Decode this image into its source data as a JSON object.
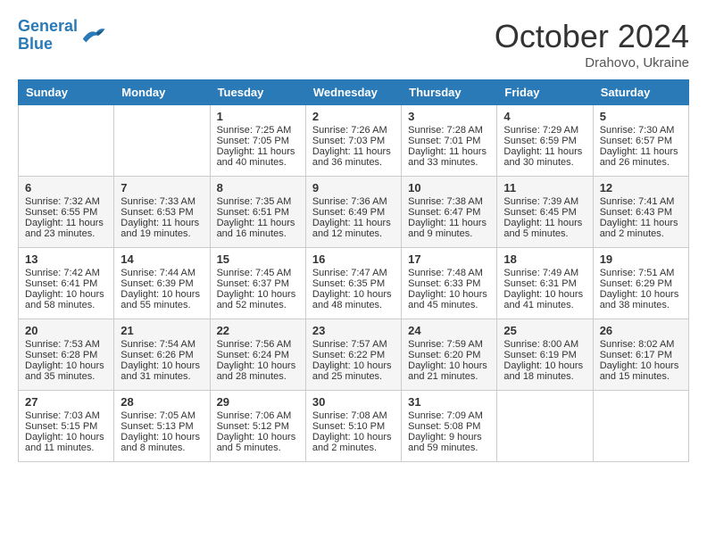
{
  "header": {
    "logo_line1": "General",
    "logo_line2": "Blue",
    "month": "October 2024",
    "location": "Drahovo, Ukraine"
  },
  "weekdays": [
    "Sunday",
    "Monday",
    "Tuesday",
    "Wednesday",
    "Thursday",
    "Friday",
    "Saturday"
  ],
  "rows": [
    [
      {
        "day": "",
        "info": ""
      },
      {
        "day": "",
        "info": ""
      },
      {
        "day": "1",
        "info": "Sunrise: 7:25 AM\nSunset: 7:05 PM\nDaylight: 11 hours and 40 minutes."
      },
      {
        "day": "2",
        "info": "Sunrise: 7:26 AM\nSunset: 7:03 PM\nDaylight: 11 hours and 36 minutes."
      },
      {
        "day": "3",
        "info": "Sunrise: 7:28 AM\nSunset: 7:01 PM\nDaylight: 11 hours and 33 minutes."
      },
      {
        "day": "4",
        "info": "Sunrise: 7:29 AM\nSunset: 6:59 PM\nDaylight: 11 hours and 30 minutes."
      },
      {
        "day": "5",
        "info": "Sunrise: 7:30 AM\nSunset: 6:57 PM\nDaylight: 11 hours and 26 minutes."
      }
    ],
    [
      {
        "day": "6",
        "info": "Sunrise: 7:32 AM\nSunset: 6:55 PM\nDaylight: 11 hours and 23 minutes."
      },
      {
        "day": "7",
        "info": "Sunrise: 7:33 AM\nSunset: 6:53 PM\nDaylight: 11 hours and 19 minutes."
      },
      {
        "day": "8",
        "info": "Sunrise: 7:35 AM\nSunset: 6:51 PM\nDaylight: 11 hours and 16 minutes."
      },
      {
        "day": "9",
        "info": "Sunrise: 7:36 AM\nSunset: 6:49 PM\nDaylight: 11 hours and 12 minutes."
      },
      {
        "day": "10",
        "info": "Sunrise: 7:38 AM\nSunset: 6:47 PM\nDaylight: 11 hours and 9 minutes."
      },
      {
        "day": "11",
        "info": "Sunrise: 7:39 AM\nSunset: 6:45 PM\nDaylight: 11 hours and 5 minutes."
      },
      {
        "day": "12",
        "info": "Sunrise: 7:41 AM\nSunset: 6:43 PM\nDaylight: 11 hours and 2 minutes."
      }
    ],
    [
      {
        "day": "13",
        "info": "Sunrise: 7:42 AM\nSunset: 6:41 PM\nDaylight: 10 hours and 58 minutes."
      },
      {
        "day": "14",
        "info": "Sunrise: 7:44 AM\nSunset: 6:39 PM\nDaylight: 10 hours and 55 minutes."
      },
      {
        "day": "15",
        "info": "Sunrise: 7:45 AM\nSunset: 6:37 PM\nDaylight: 10 hours and 52 minutes."
      },
      {
        "day": "16",
        "info": "Sunrise: 7:47 AM\nSunset: 6:35 PM\nDaylight: 10 hours and 48 minutes."
      },
      {
        "day": "17",
        "info": "Sunrise: 7:48 AM\nSunset: 6:33 PM\nDaylight: 10 hours and 45 minutes."
      },
      {
        "day": "18",
        "info": "Sunrise: 7:49 AM\nSunset: 6:31 PM\nDaylight: 10 hours and 41 minutes."
      },
      {
        "day": "19",
        "info": "Sunrise: 7:51 AM\nSunset: 6:29 PM\nDaylight: 10 hours and 38 minutes."
      }
    ],
    [
      {
        "day": "20",
        "info": "Sunrise: 7:53 AM\nSunset: 6:28 PM\nDaylight: 10 hours and 35 minutes."
      },
      {
        "day": "21",
        "info": "Sunrise: 7:54 AM\nSunset: 6:26 PM\nDaylight: 10 hours and 31 minutes."
      },
      {
        "day": "22",
        "info": "Sunrise: 7:56 AM\nSunset: 6:24 PM\nDaylight: 10 hours and 28 minutes."
      },
      {
        "day": "23",
        "info": "Sunrise: 7:57 AM\nSunset: 6:22 PM\nDaylight: 10 hours and 25 minutes."
      },
      {
        "day": "24",
        "info": "Sunrise: 7:59 AM\nSunset: 6:20 PM\nDaylight: 10 hours and 21 minutes."
      },
      {
        "day": "25",
        "info": "Sunrise: 8:00 AM\nSunset: 6:19 PM\nDaylight: 10 hours and 18 minutes."
      },
      {
        "day": "26",
        "info": "Sunrise: 8:02 AM\nSunset: 6:17 PM\nDaylight: 10 hours and 15 minutes."
      }
    ],
    [
      {
        "day": "27",
        "info": "Sunrise: 7:03 AM\nSunset: 5:15 PM\nDaylight: 10 hours and 11 minutes."
      },
      {
        "day": "28",
        "info": "Sunrise: 7:05 AM\nSunset: 5:13 PM\nDaylight: 10 hours and 8 minutes."
      },
      {
        "day": "29",
        "info": "Sunrise: 7:06 AM\nSunset: 5:12 PM\nDaylight: 10 hours and 5 minutes."
      },
      {
        "day": "30",
        "info": "Sunrise: 7:08 AM\nSunset: 5:10 PM\nDaylight: 10 hours and 2 minutes."
      },
      {
        "day": "31",
        "info": "Sunrise: 7:09 AM\nSunset: 5:08 PM\nDaylight: 9 hours and 59 minutes."
      },
      {
        "day": "",
        "info": ""
      },
      {
        "day": "",
        "info": ""
      }
    ]
  ]
}
